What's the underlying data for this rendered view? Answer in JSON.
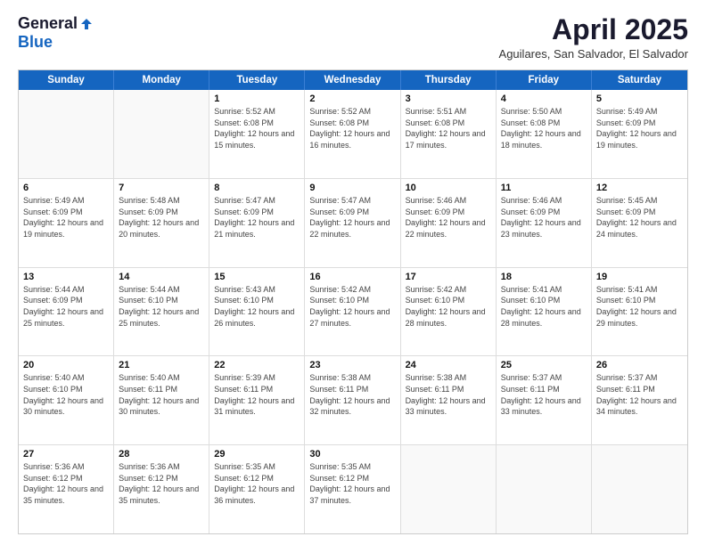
{
  "header": {
    "logo_general": "General",
    "logo_blue": "Blue",
    "month_title": "April 2025",
    "location": "Aguilares, San Salvador, El Salvador"
  },
  "days_of_week": [
    "Sunday",
    "Monday",
    "Tuesday",
    "Wednesday",
    "Thursday",
    "Friday",
    "Saturday"
  ],
  "weeks": [
    [
      {
        "day": "",
        "info": ""
      },
      {
        "day": "",
        "info": ""
      },
      {
        "day": "1",
        "info": "Sunrise: 5:52 AM\nSunset: 6:08 PM\nDaylight: 12 hours and 15 minutes."
      },
      {
        "day": "2",
        "info": "Sunrise: 5:52 AM\nSunset: 6:08 PM\nDaylight: 12 hours and 16 minutes."
      },
      {
        "day": "3",
        "info": "Sunrise: 5:51 AM\nSunset: 6:08 PM\nDaylight: 12 hours and 17 minutes."
      },
      {
        "day": "4",
        "info": "Sunrise: 5:50 AM\nSunset: 6:08 PM\nDaylight: 12 hours and 18 minutes."
      },
      {
        "day": "5",
        "info": "Sunrise: 5:49 AM\nSunset: 6:09 PM\nDaylight: 12 hours and 19 minutes."
      }
    ],
    [
      {
        "day": "6",
        "info": "Sunrise: 5:49 AM\nSunset: 6:09 PM\nDaylight: 12 hours and 19 minutes."
      },
      {
        "day": "7",
        "info": "Sunrise: 5:48 AM\nSunset: 6:09 PM\nDaylight: 12 hours and 20 minutes."
      },
      {
        "day": "8",
        "info": "Sunrise: 5:47 AM\nSunset: 6:09 PM\nDaylight: 12 hours and 21 minutes."
      },
      {
        "day": "9",
        "info": "Sunrise: 5:47 AM\nSunset: 6:09 PM\nDaylight: 12 hours and 22 minutes."
      },
      {
        "day": "10",
        "info": "Sunrise: 5:46 AM\nSunset: 6:09 PM\nDaylight: 12 hours and 22 minutes."
      },
      {
        "day": "11",
        "info": "Sunrise: 5:46 AM\nSunset: 6:09 PM\nDaylight: 12 hours and 23 minutes."
      },
      {
        "day": "12",
        "info": "Sunrise: 5:45 AM\nSunset: 6:09 PM\nDaylight: 12 hours and 24 minutes."
      }
    ],
    [
      {
        "day": "13",
        "info": "Sunrise: 5:44 AM\nSunset: 6:09 PM\nDaylight: 12 hours and 25 minutes."
      },
      {
        "day": "14",
        "info": "Sunrise: 5:44 AM\nSunset: 6:10 PM\nDaylight: 12 hours and 25 minutes."
      },
      {
        "day": "15",
        "info": "Sunrise: 5:43 AM\nSunset: 6:10 PM\nDaylight: 12 hours and 26 minutes."
      },
      {
        "day": "16",
        "info": "Sunrise: 5:42 AM\nSunset: 6:10 PM\nDaylight: 12 hours and 27 minutes."
      },
      {
        "day": "17",
        "info": "Sunrise: 5:42 AM\nSunset: 6:10 PM\nDaylight: 12 hours and 28 minutes."
      },
      {
        "day": "18",
        "info": "Sunrise: 5:41 AM\nSunset: 6:10 PM\nDaylight: 12 hours and 28 minutes."
      },
      {
        "day": "19",
        "info": "Sunrise: 5:41 AM\nSunset: 6:10 PM\nDaylight: 12 hours and 29 minutes."
      }
    ],
    [
      {
        "day": "20",
        "info": "Sunrise: 5:40 AM\nSunset: 6:10 PM\nDaylight: 12 hours and 30 minutes."
      },
      {
        "day": "21",
        "info": "Sunrise: 5:40 AM\nSunset: 6:11 PM\nDaylight: 12 hours and 30 minutes."
      },
      {
        "day": "22",
        "info": "Sunrise: 5:39 AM\nSunset: 6:11 PM\nDaylight: 12 hours and 31 minutes."
      },
      {
        "day": "23",
        "info": "Sunrise: 5:38 AM\nSunset: 6:11 PM\nDaylight: 12 hours and 32 minutes."
      },
      {
        "day": "24",
        "info": "Sunrise: 5:38 AM\nSunset: 6:11 PM\nDaylight: 12 hours and 33 minutes."
      },
      {
        "day": "25",
        "info": "Sunrise: 5:37 AM\nSunset: 6:11 PM\nDaylight: 12 hours and 33 minutes."
      },
      {
        "day": "26",
        "info": "Sunrise: 5:37 AM\nSunset: 6:11 PM\nDaylight: 12 hours and 34 minutes."
      }
    ],
    [
      {
        "day": "27",
        "info": "Sunrise: 5:36 AM\nSunset: 6:12 PM\nDaylight: 12 hours and 35 minutes."
      },
      {
        "day": "28",
        "info": "Sunrise: 5:36 AM\nSunset: 6:12 PM\nDaylight: 12 hours and 35 minutes."
      },
      {
        "day": "29",
        "info": "Sunrise: 5:35 AM\nSunset: 6:12 PM\nDaylight: 12 hours and 36 minutes."
      },
      {
        "day": "30",
        "info": "Sunrise: 5:35 AM\nSunset: 6:12 PM\nDaylight: 12 hours and 37 minutes."
      },
      {
        "day": "",
        "info": ""
      },
      {
        "day": "",
        "info": ""
      },
      {
        "day": "",
        "info": ""
      }
    ]
  ]
}
